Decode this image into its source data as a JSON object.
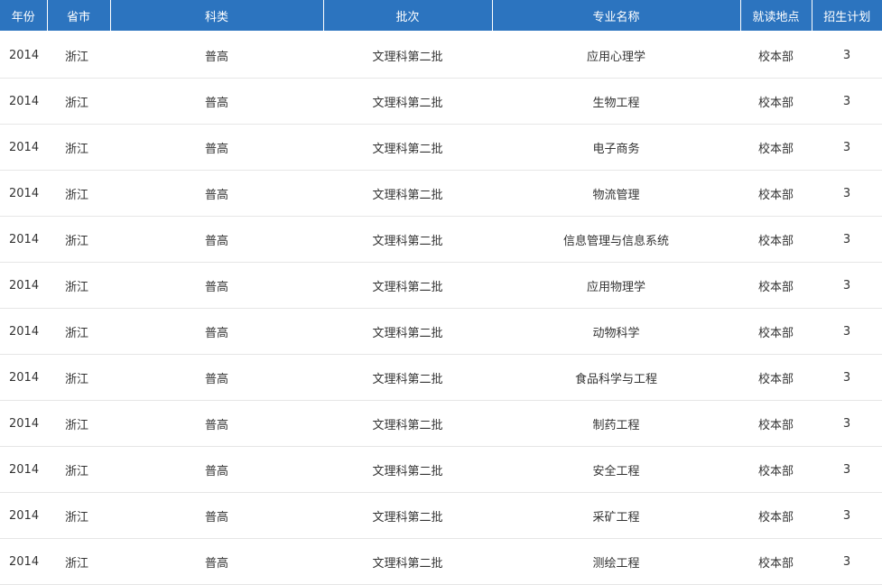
{
  "table": {
    "headers": [
      "年份",
      "省市",
      "科类",
      "批次",
      "专业名称",
      "就读地点",
      "招生计划"
    ],
    "rows": [
      {
        "year": "2014",
        "province": "浙江",
        "category": "普高",
        "batch": "文理科第二批",
        "major": "应用心理学",
        "location": "校本部",
        "plan": "3"
      },
      {
        "year": "2014",
        "province": "浙江",
        "category": "普高",
        "batch": "文理科第二批",
        "major": "生物工程",
        "location": "校本部",
        "plan": "3"
      },
      {
        "year": "2014",
        "province": "浙江",
        "category": "普高",
        "batch": "文理科第二批",
        "major": "电子商务",
        "location": "校本部",
        "plan": "3"
      },
      {
        "year": "2014",
        "province": "浙江",
        "category": "普高",
        "batch": "文理科第二批",
        "major": "物流管理",
        "location": "校本部",
        "plan": "3"
      },
      {
        "year": "2014",
        "province": "浙江",
        "category": "普高",
        "batch": "文理科第二批",
        "major": "信息管理与信息系统",
        "location": "校本部",
        "plan": "3"
      },
      {
        "year": "2014",
        "province": "浙江",
        "category": "普高",
        "batch": "文理科第二批",
        "major": "应用物理学",
        "location": "校本部",
        "plan": "3"
      },
      {
        "year": "2014",
        "province": "浙江",
        "category": "普高",
        "batch": "文理科第二批",
        "major": "动物科学",
        "location": "校本部",
        "plan": "3"
      },
      {
        "year": "2014",
        "province": "浙江",
        "category": "普高",
        "batch": "文理科第二批",
        "major": "食品科学与工程",
        "location": "校本部",
        "plan": "3"
      },
      {
        "year": "2014",
        "province": "浙江",
        "category": "普高",
        "batch": "文理科第二批",
        "major": "制药工程",
        "location": "校本部",
        "plan": "3"
      },
      {
        "year": "2014",
        "province": "浙江",
        "category": "普高",
        "batch": "文理科第二批",
        "major": "安全工程",
        "location": "校本部",
        "plan": "3"
      },
      {
        "year": "2014",
        "province": "浙江",
        "category": "普高",
        "batch": "文理科第二批",
        "major": "采矿工程",
        "location": "校本部",
        "plan": "3"
      },
      {
        "year": "2014",
        "province": "浙江",
        "category": "普高",
        "batch": "文理科第二批",
        "major": "测绘工程",
        "location": "校本部",
        "plan": "3"
      }
    ]
  },
  "colors": {
    "header_bg": "#2c74bf",
    "header_text": "#ffffff",
    "row_border": "#e6e6e6",
    "body_text": "#333333"
  }
}
